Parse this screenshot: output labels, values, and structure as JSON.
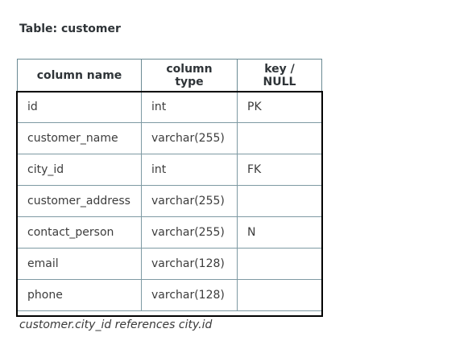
{
  "title": "Table: customer",
  "headers": [
    "column name",
    "column type",
    "key / NULL"
  ],
  "rows": [
    [
      "id",
      "int",
      "PK"
    ],
    [
      "customer_name",
      "varchar(255)",
      ""
    ],
    [
      "city_id",
      "int",
      "FK"
    ],
    [
      "customer_address",
      "varchar(255)",
      ""
    ],
    [
      "contact_person",
      "varchar(255)",
      "N"
    ],
    [
      "email",
      "varchar(128)",
      ""
    ],
    [
      "phone",
      "varchar(128)",
      ""
    ]
  ],
  "note": "customer.city_id references city.id",
  "colors": {
    "cell_border": "#7e9aa3",
    "body_frame": "#000000",
    "text": "#3c3c3c"
  }
}
